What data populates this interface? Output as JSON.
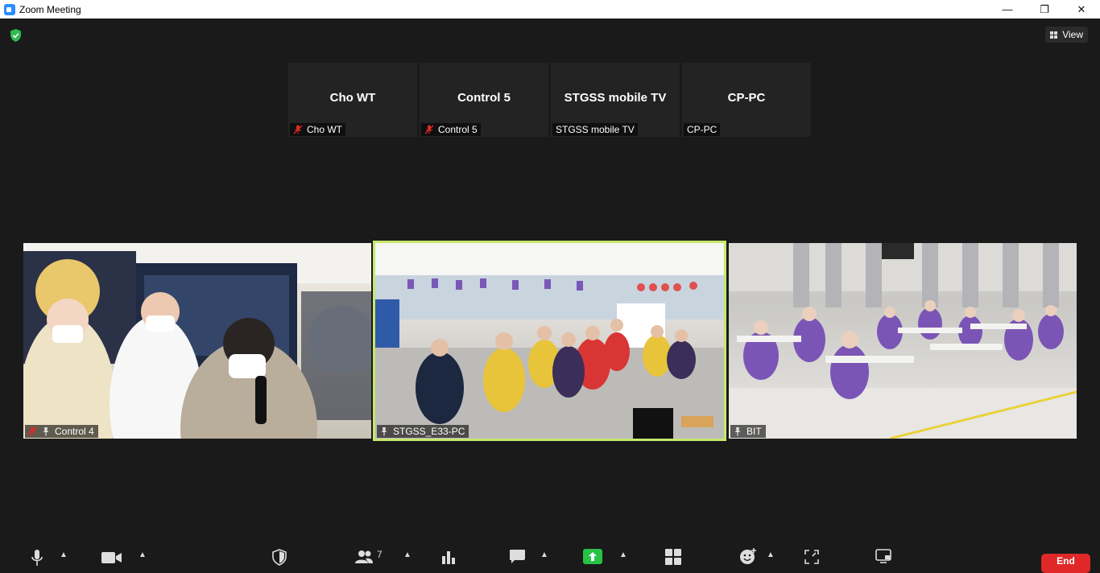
{
  "window": {
    "title": "Zoom Meeting",
    "controls": [
      "—",
      "❐",
      "✕"
    ]
  },
  "header": {
    "view_label": "View"
  },
  "thumbnails": [
    {
      "name": "Cho WT",
      "tag": "Cho WT",
      "muted": true
    },
    {
      "name": "Control 5",
      "tag": "Control 5",
      "muted": true
    },
    {
      "name": "STGSS mobile TV",
      "tag": "STGSS mobile TV",
      "muted": false
    },
    {
      "name": "CP-PC",
      "tag": "CP-PC",
      "muted": false
    }
  ],
  "videos": [
    {
      "tag": "Control 4",
      "muted": true,
      "pinned": true
    },
    {
      "tag": "STGSS_E33-PC",
      "muted": false,
      "pinned": true,
      "active": true
    },
    {
      "tag": "BIT",
      "muted": false,
      "pinned": true
    }
  ],
  "toolbar": {
    "participants_count": "7",
    "end_label": "End"
  },
  "colors": {
    "background": "#1a1a1a",
    "active_speaker": "#c5e86c",
    "end": "#e02828",
    "share": "#27c246",
    "security": "#2fba52"
  }
}
